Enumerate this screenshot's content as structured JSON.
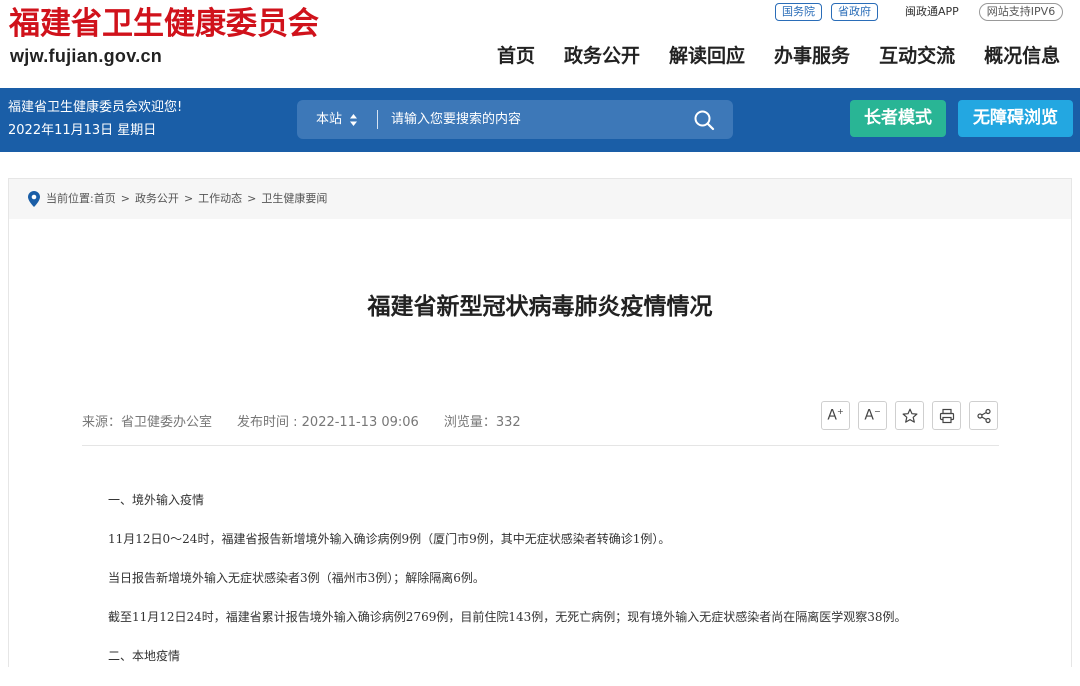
{
  "header": {
    "title": "福建省卫生健康委员会",
    "url": "wjw.fujian.gov.cn",
    "top_links": {
      "gwy": "国务院",
      "szf": "省政府",
      "app": "闽政通APP",
      "ipv6": "网站支持IPV6"
    },
    "nav": [
      "首页",
      "政务公开",
      "解读回应",
      "办事服务",
      "互动交流",
      "概况信息"
    ]
  },
  "bluebar": {
    "welcome": "福建省卫生健康委员会欢迎您!",
    "date": "2022年11月13日 星期日",
    "search_scope": "本站",
    "search_placeholder": "请输入您要搜索的内容",
    "elder_mode": "长者模式",
    "accessible": "无障碍浏览",
    "colors": {
      "bar": "#1a5ea7",
      "elder": "#29b595",
      "access": "#23a7e1"
    }
  },
  "breadcrumb": {
    "label": "当前位置:",
    "items": [
      "首页",
      "政务公开",
      "工作动态",
      "卫生健康要闻"
    ],
    "separator": ">"
  },
  "article": {
    "title": "福建省新型冠状病毒肺炎疫情情况",
    "source": "来源：省卫健委办公室",
    "publish_time": "发布时间 : 2022-11-13 09:06",
    "views": "浏览量：332",
    "tools": [
      "A+",
      "A-",
      "star-icon",
      "print-icon",
      "share-icon"
    ],
    "paragraphs": [
      "一、境外输入疫情",
      "11月12日0～24时，福建省报告新增境外输入确诊病例9例（厦门市9例，其中无症状感染者转确诊1例）。",
      "当日报告新增境外输入无症状感染者3例（福州市3例）；解除隔离6例。",
      "截至11月12日24时，福建省累计报告境外输入确诊病例2769例，目前住院143例，无死亡病例；现有境外输入无症状感染者尚在隔离医学观察38例。",
      "二、本地疫情"
    ]
  }
}
